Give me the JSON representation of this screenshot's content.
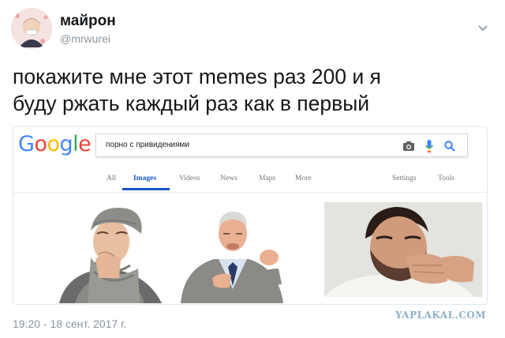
{
  "tweet": {
    "display_name": "майрон",
    "handle": "@mrwurei",
    "text_line1": "покажите мне этот memes раз 200 и я",
    "text_line2": "буду ржать каждый раз как в первый",
    "timestamp": "19:20 - 18 сент. 2017 г.",
    "caret_icon": "chevron-down-icon"
  },
  "embedded_screenshot": {
    "logo_letters": [
      "G",
      "o",
      "o",
      "g",
      "l",
      "e"
    ],
    "logo_colors": [
      "#4285f4",
      "#ea4335",
      "#fbbc05",
      "#4285f4",
      "#34a853",
      "#ea4335"
    ],
    "search_query": "порно с привидениями",
    "search_icons": [
      "camera-icon",
      "microphone-icon",
      "search-icon"
    ],
    "tabs": [
      {
        "label": "All"
      },
      {
        "label": "Images",
        "active": true
      },
      {
        "label": "Videos"
      },
      {
        "label": "News"
      },
      {
        "label": "Maps"
      },
      {
        "label": "More"
      },
      {
        "label": "Settings"
      },
      {
        "label": "Tools"
      }
    ],
    "accent_color": "#1a57c9",
    "images": [
      "coughing-young-man-scarf",
      "coughing-older-man-cardigan",
      "coughing-bearded-man"
    ]
  },
  "watermark": "YAPLAKAL.COM"
}
